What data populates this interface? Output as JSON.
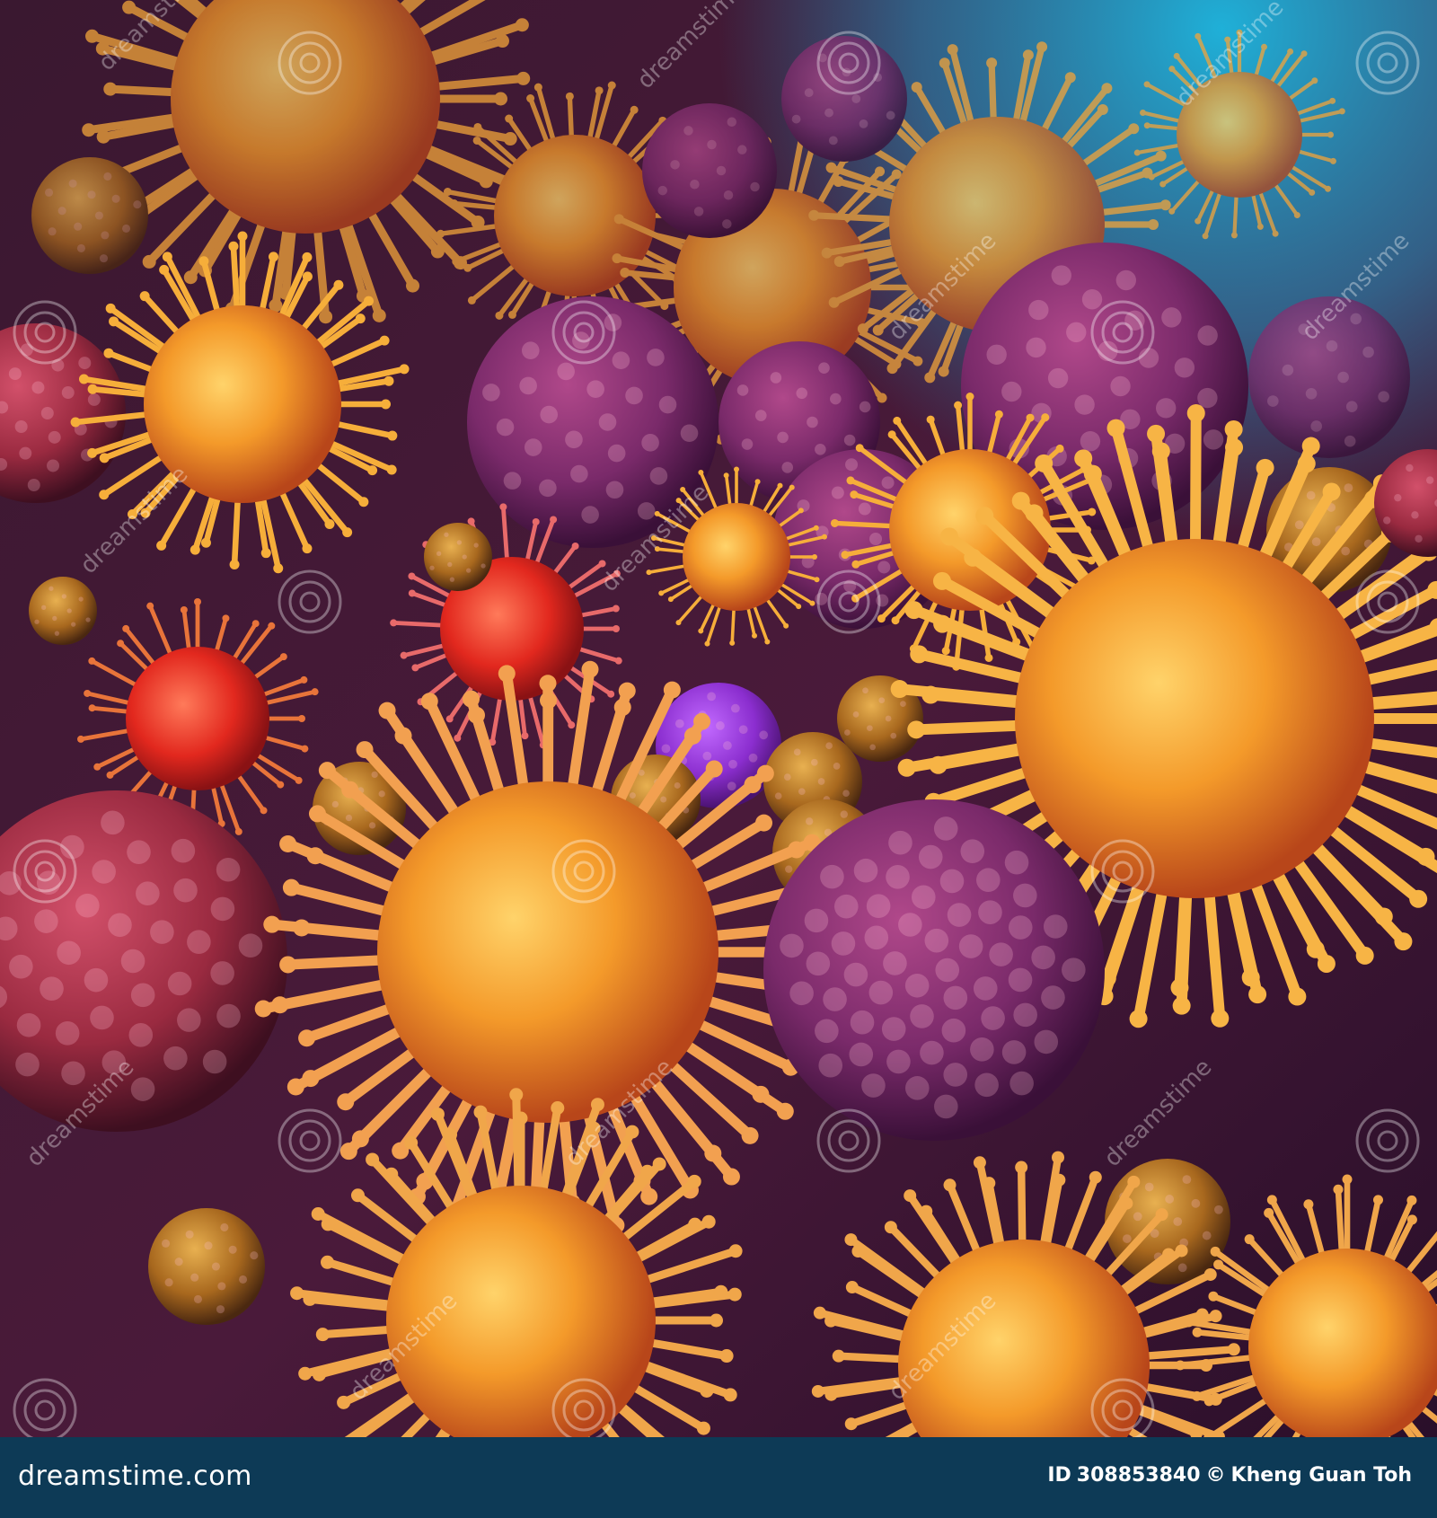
{
  "image": {
    "subject": "microscopic cells and spiky virus particles on purple tissue",
    "palette": {
      "background_top": "#1a9ac0",
      "tissue_dark": "#2a1030",
      "virus_orange": "#f08a1e",
      "virus_red": "#e2281e",
      "cell_purple": "#7a2a6a",
      "cell_violet": "#8b2ecf",
      "granule_gold": "#b87a2a"
    }
  },
  "watermark": {
    "text": "dreamstime",
    "icon": "spiral-logo-icon"
  },
  "footer": {
    "site": "dreamstime.com",
    "id_label": "ID",
    "id_value": "308853840",
    "copyright_symbol": "©",
    "author": "Kheng Guan Toh"
  }
}
